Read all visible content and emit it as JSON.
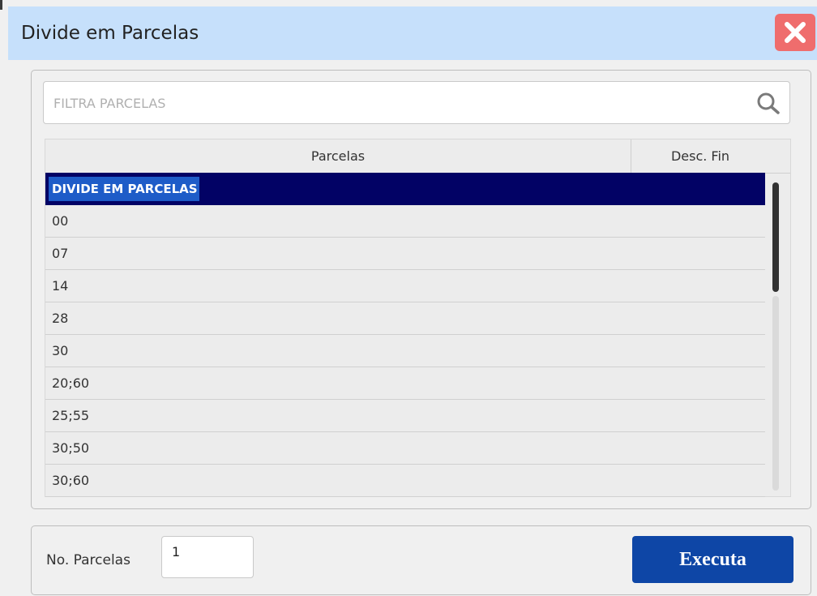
{
  "window": {
    "title": "Divide em Parcelas"
  },
  "search": {
    "placeholder": "FILTRA PARCELAS",
    "value": ""
  },
  "table": {
    "columns": [
      "Parcelas",
      "Desc. Fin"
    ],
    "rows": [
      "DIVIDE EM PARCELAS",
      "00",
      "07",
      "14",
      "28",
      "30",
      "20;60",
      "25;55",
      "30;50",
      "30;60"
    ],
    "selected_index": 0
  },
  "footer": {
    "parcelas_label": "No. Parcelas",
    "parcelas_value": "1",
    "execute_label": "Executa"
  },
  "colors": {
    "titlebar": "#c6e0fb",
    "close_button": "#ef6d6d",
    "selected_row": "#020265",
    "execute_button": "#0e46a6"
  }
}
